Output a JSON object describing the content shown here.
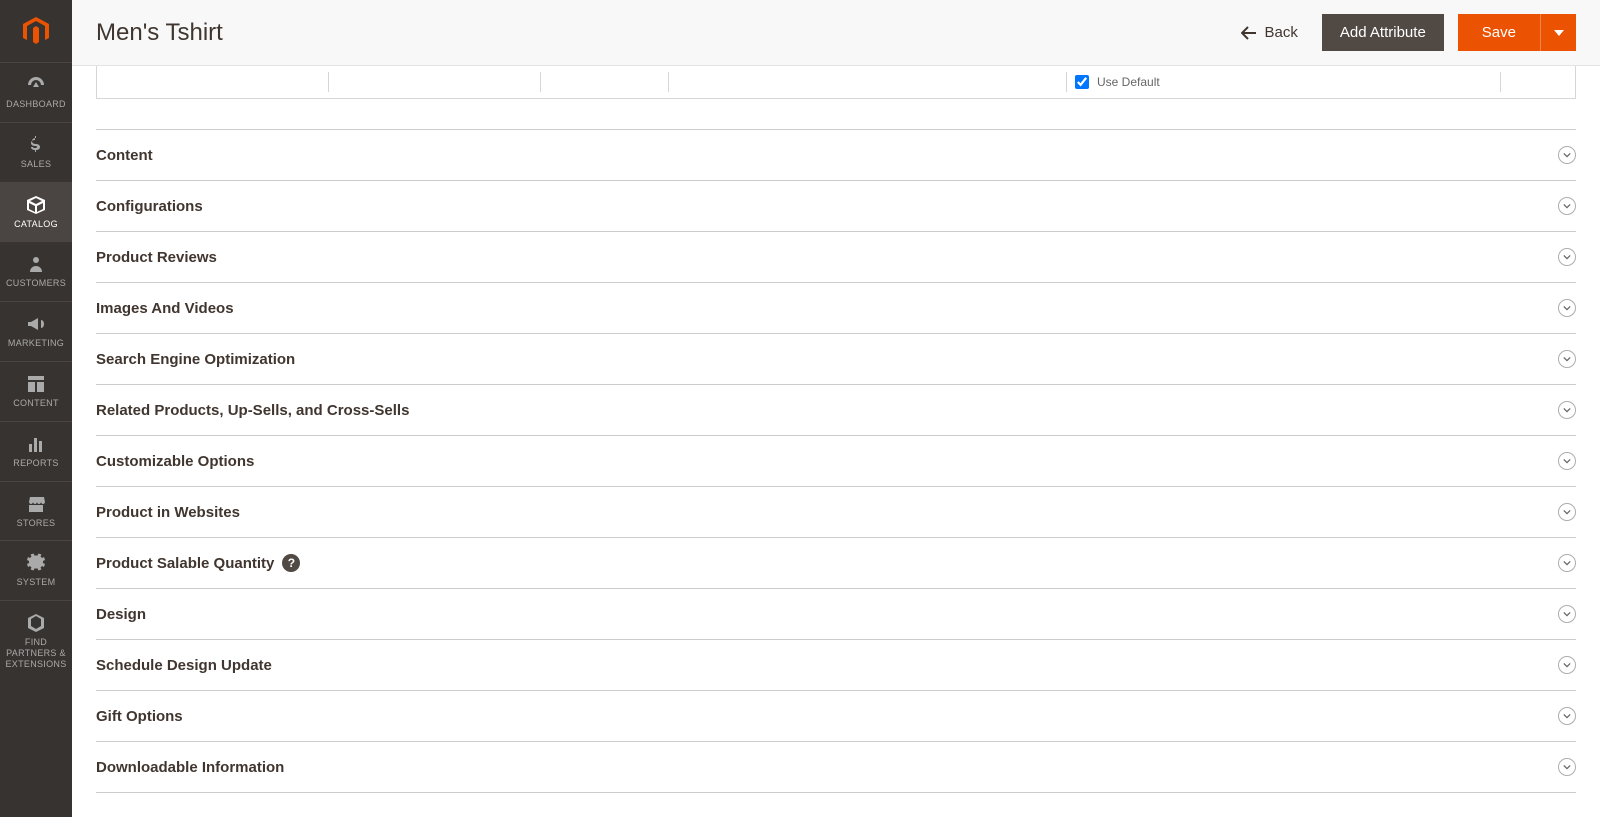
{
  "header": {
    "title": "Men's Tshirt",
    "back_label": "Back",
    "add_attribute_label": "Add Attribute",
    "save_label": "Save"
  },
  "sidebar": {
    "items": [
      {
        "label": "DASHBOARD",
        "icon": "dashboard-icon"
      },
      {
        "label": "SALES",
        "icon": "dollar-icon"
      },
      {
        "label": "CATALOG",
        "icon": "box-icon"
      },
      {
        "label": "CUSTOMERS",
        "icon": "person-icon"
      },
      {
        "label": "MARKETING",
        "icon": "megaphone-icon"
      },
      {
        "label": "CONTENT",
        "icon": "layout-icon"
      },
      {
        "label": "REPORTS",
        "icon": "bars-icon"
      },
      {
        "label": "STORES",
        "icon": "storefront-icon"
      },
      {
        "label": "SYSTEM",
        "icon": "gear-icon"
      },
      {
        "label": "FIND PARTNERS & EXTENSIONS",
        "icon": "puzzle-icon"
      }
    ],
    "active_index": 2
  },
  "use_default": {
    "label": "Use Default",
    "checked": true
  },
  "sections": [
    {
      "title": "Content",
      "has_help": false
    },
    {
      "title": "Configurations",
      "has_help": false
    },
    {
      "title": "Product Reviews",
      "has_help": false
    },
    {
      "title": "Images And Videos",
      "has_help": false
    },
    {
      "title": "Search Engine Optimization",
      "has_help": false
    },
    {
      "title": "Related Products, Up-Sells, and Cross-Sells",
      "has_help": false
    },
    {
      "title": "Customizable Options",
      "has_help": false
    },
    {
      "title": "Product in Websites",
      "has_help": false
    },
    {
      "title": "Product Salable Quantity",
      "has_help": true
    },
    {
      "title": "Design",
      "has_help": false
    },
    {
      "title": "Schedule Design Update",
      "has_help": false
    },
    {
      "title": "Gift Options",
      "has_help": false
    },
    {
      "title": "Downloadable Information",
      "has_help": false
    }
  ]
}
